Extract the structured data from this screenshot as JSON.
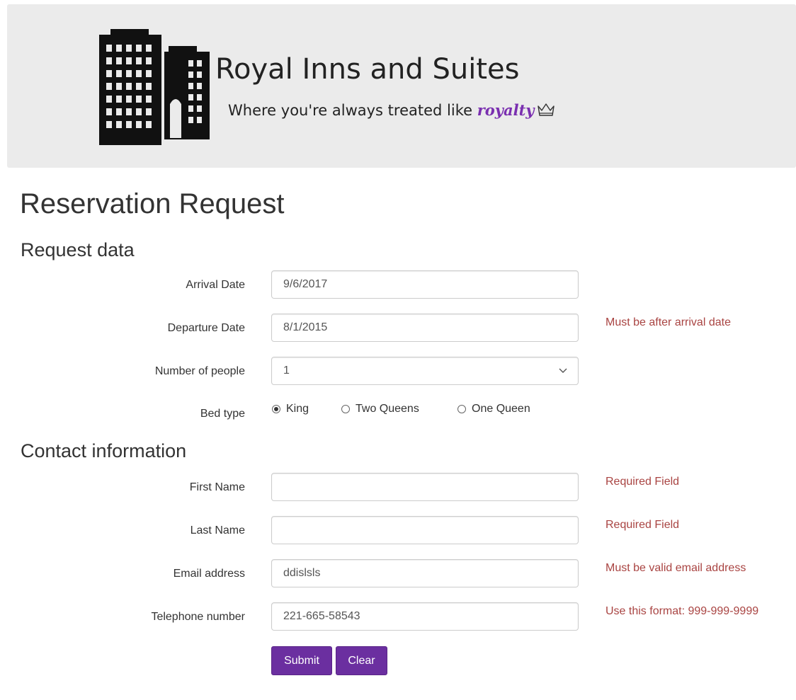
{
  "header": {
    "brand_name": "Royal Inns and Suites",
    "tagline_prefix": "Where you're always treated like ",
    "tagline_emphasis": "royalty",
    "accent_color": "#7a2fb0"
  },
  "page_title": "Reservation Request",
  "request_section": {
    "title": "Request data",
    "arrival_date": {
      "label": "Arrival Date",
      "value": "9/6/2017",
      "error": ""
    },
    "departure_date": {
      "label": "Departure Date",
      "value": "8/1/2015",
      "error": "Must be after arrival date"
    },
    "number_of_people": {
      "label": "Number of people",
      "value": "1"
    },
    "bed_type": {
      "label": "Bed type",
      "options": [
        {
          "label": "King",
          "checked": true
        },
        {
          "label": "Two Queens",
          "checked": false
        },
        {
          "label": "One Queen",
          "checked": false
        }
      ]
    }
  },
  "contact_section": {
    "title": "Contact information",
    "first_name": {
      "label": "First Name",
      "value": "",
      "error": "Required Field"
    },
    "last_name": {
      "label": "Last Name",
      "value": "",
      "error": "Required Field"
    },
    "email": {
      "label": "Email address",
      "value": "ddislsls",
      "error": "Must be valid email address"
    },
    "telephone": {
      "label": "Telephone number",
      "value": "221-665-58543",
      "error": "Use this format: 999-999-9999"
    }
  },
  "buttons": {
    "submit": "Submit",
    "clear": "Clear",
    "color": "#6b2fa0"
  },
  "icons": {
    "logo": "hotel-building-icon",
    "crown": "crown-icon",
    "select_arrow": "chevron-down-icon"
  }
}
